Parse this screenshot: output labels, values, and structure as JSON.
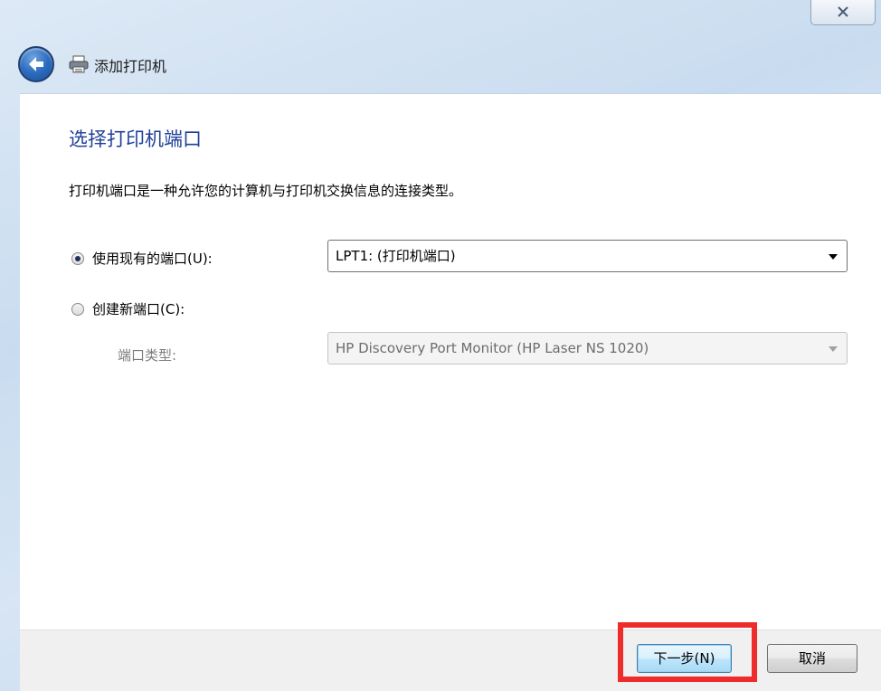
{
  "window": {
    "close_glyph": "⊠",
    "title": "添加打印机"
  },
  "page": {
    "heading": "选择打印机端口",
    "description": "打印机端口是一种允许您的计算机与打印机交换信息的连接类型。"
  },
  "options": {
    "existing_port": {
      "label": "使用现有的端口(U):",
      "selected": true,
      "value": "LPT1: (打印机端口)"
    },
    "new_port": {
      "label": "创建新端口(C):",
      "selected": false,
      "type_label": "端口类型:",
      "type_value": "HP Discovery Port Monitor (HP Laser NS 1020)"
    }
  },
  "buttons": {
    "next": "下一步(N)",
    "cancel": "取消"
  },
  "colors": {
    "heading": "#1f3f9a",
    "highlight": "#ee2c2c"
  }
}
